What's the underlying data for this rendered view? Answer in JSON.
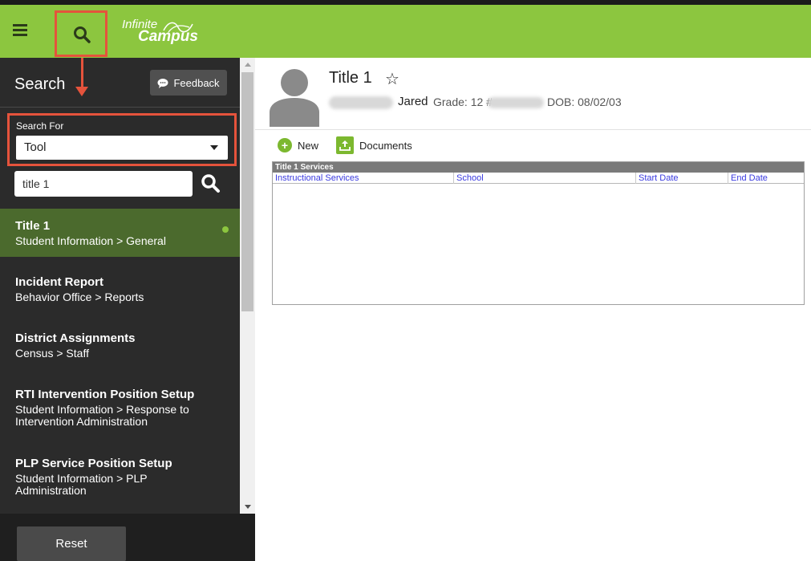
{
  "header": {
    "logo_line1": "Infinite",
    "logo_line2": "Campus"
  },
  "sidebar": {
    "title": "Search",
    "feedback_label": "Feedback",
    "search_for_label": "Search For",
    "search_for_value": "Tool",
    "search_query": "title 1",
    "results": [
      {
        "title": "Title 1",
        "path": "Student Information > General",
        "active": true
      },
      {
        "title": "Incident Report",
        "path": "Behavior Office > Reports"
      },
      {
        "title": "District Assignments",
        "path": "Census > Staff"
      },
      {
        "title": "RTI Intervention Position Setup",
        "path": "Student Information > Response to Intervention Administration"
      },
      {
        "title": "PLP Service Position Setup",
        "path": "Student Information > PLP Administration"
      }
    ],
    "reset_label": "Reset"
  },
  "content": {
    "page_title": "Title 1",
    "student_first_name": "Jared",
    "grade_text": "Grade: 12 #",
    "dob_text": "DOB: 08/02/03",
    "toolbar": {
      "new_label": "New",
      "documents_label": "Documents"
    },
    "table": {
      "title": "Title 1 Services",
      "columns": [
        "Instructional Services",
        "School",
        "Start Date",
        "End Date"
      ],
      "rows": []
    }
  },
  "colors": {
    "brand_green": "#8cc63f",
    "sidebar_bg": "#2b2b2b",
    "active_row": "#4b6a2d",
    "annotation_red": "#e5533c"
  }
}
